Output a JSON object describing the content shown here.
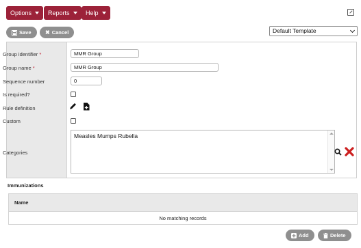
{
  "menu": {
    "options": "Options",
    "reports": "Reports",
    "help": "Help"
  },
  "toolbar": {
    "save": "Save",
    "cancel": "Cancel",
    "template_selected": "Default Template"
  },
  "form": {
    "group_identifier": {
      "label": "Group identifier",
      "required": "*",
      "value": "MMR Group"
    },
    "group_name": {
      "label": "Group name",
      "required": "*",
      "value": "MMR Group"
    },
    "sequence_number": {
      "label": "Sequence number",
      "value": "0"
    },
    "is_required": {
      "label": "Is required?",
      "checked": false
    },
    "rule_definition": {
      "label": "Rule definition"
    },
    "custom": {
      "label": "Custom",
      "checked": false
    },
    "categories": {
      "label": "Categories",
      "value": "Measles Mumps Rubella"
    }
  },
  "immunizations": {
    "title": "Immunizations",
    "columns": [
      "Name"
    ],
    "empty_text": "No matching records",
    "add": "Add",
    "delete": "Delete"
  },
  "colors": {
    "brand": "#9c2239",
    "pill": "#8f8f8f",
    "remove_icon": "#cc1f1f"
  },
  "icons": [
    "chevron-down-icon",
    "popout-icon",
    "save-icon",
    "cancel-icon",
    "pencil-icon",
    "file-add-icon",
    "search-icon",
    "remove-icon",
    "plus-icon",
    "trash-icon"
  ]
}
